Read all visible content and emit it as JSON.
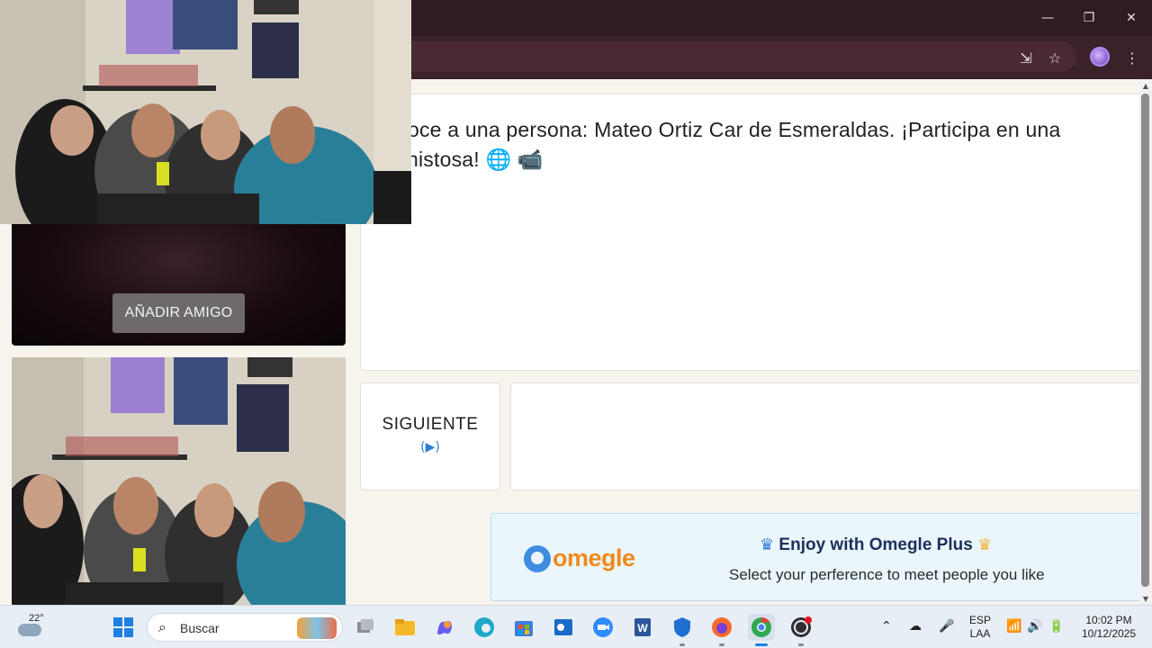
{
  "window": {
    "minimize_glyph": "—",
    "restore_glyph": "❐",
    "close_glyph": "✕"
  },
  "toolbar": {
    "icons": [
      "install-app-icon",
      "bookmark-star-icon",
      "profile-avatar",
      "menu-kebab-icon"
    ]
  },
  "chat": {
    "line1": "noce a una persona: Mateo Ortiz Car de Esmeraldas. ¡Participa en una",
    "line2": "nistosa! 🌐 📹"
  },
  "controls": {
    "next_label": "SIGUIENTE",
    "next_keys": "(▶)"
  },
  "video": {
    "add_friend_label": "AÑADIR AMIGO"
  },
  "promo": {
    "logo_text": "omegle",
    "title": "Enjoy with Omegle Plus",
    "subtitle": "Select your perference to meet people you like",
    "crown_left": "♛",
    "crown_right": "♛"
  },
  "taskbar": {
    "weather_temp": "22°",
    "search_placeholder": "Buscar",
    "language_line1": "ESP",
    "language_line2": "LAA",
    "time": "10:02 PM",
    "date": "10/12/2025",
    "apps": [
      "windows-start",
      "file-explorer",
      "files",
      "copilot",
      "edge",
      "store",
      "outlook",
      "zoom",
      "word",
      "defender",
      "firefox",
      "chrome",
      "obs-studio"
    ],
    "colors": {
      "start": "#1f7fe0",
      "files": "#f4b92b",
      "copilot": "#6a5bef",
      "edge": "#1fa8c9",
      "store": "#3b7de0",
      "outlook": "#1b6ac9",
      "zoom": "#2d8cff",
      "word": "#2b579a",
      "defender": "#1d6fd1",
      "firefox": "#ff6a2b",
      "chrome": "#2fa852",
      "obs": "#302e31"
    }
  }
}
